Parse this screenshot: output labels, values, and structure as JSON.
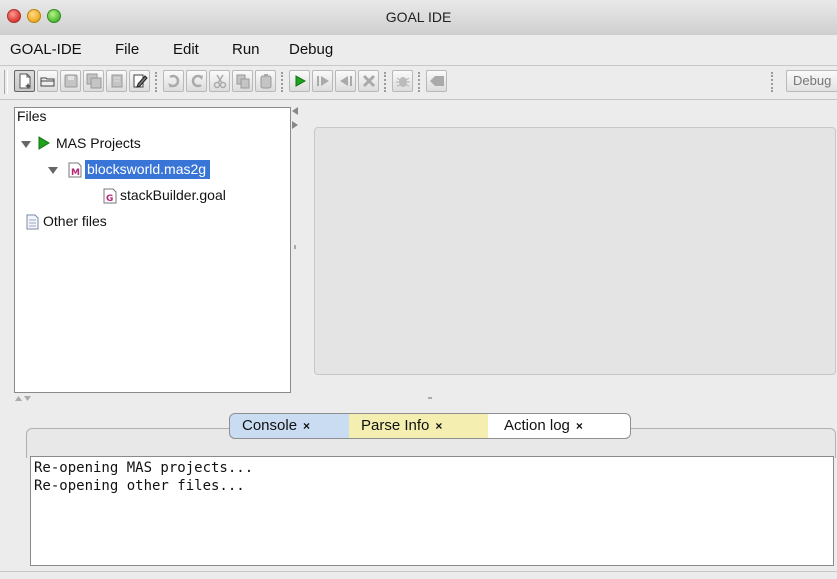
{
  "window": {
    "title": "GOAL IDE"
  },
  "menubar": {
    "items": [
      "GOAL-IDE",
      "File",
      "Edit",
      "Run",
      "Debug"
    ]
  },
  "toolbar": {
    "debug_label": "Debug"
  },
  "files_panel": {
    "header": "Files",
    "tree": {
      "mas_projects": "MAS Projects",
      "project_file": "blocksworld.mas2g",
      "goal_file": "stackBuilder.goal",
      "other_files": "Other files"
    }
  },
  "tabs": [
    {
      "label": "Console",
      "close": "×",
      "color": "#c9dcf2"
    },
    {
      "label": "Parse Info",
      "close": "×",
      "color": "#f4efb0"
    },
    {
      "label": "Action log",
      "close": "×",
      "color": "#ffffff"
    }
  ],
  "console": {
    "lines": [
      "Re-opening MAS projects...",
      "Re-opening other files..."
    ]
  },
  "colors": {
    "selection": "#3875d7",
    "play_green": "#1fa31f"
  },
  "icons": {
    "toolbar": [
      "new-file-icon",
      "open-folder-icon",
      "save-icon",
      "save-all-icon",
      "close-file-icon",
      "edit-icon",
      "undo-icon",
      "redo-icon",
      "cut-icon",
      "copy-icon",
      "paste-icon",
      "run-icon",
      "step-icon",
      "back-icon",
      "stop-icon",
      "debug-bug-icon",
      "breakpoint-icon"
    ]
  }
}
